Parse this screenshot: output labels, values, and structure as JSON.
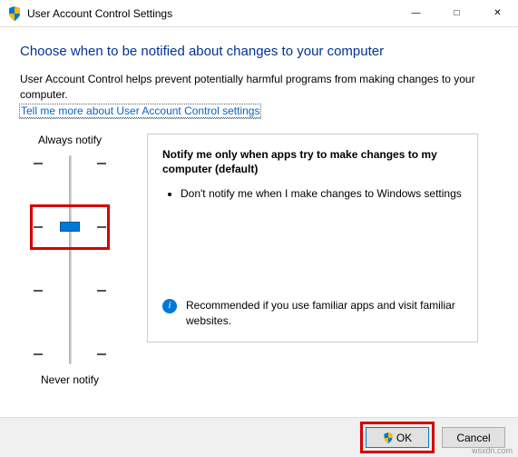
{
  "window": {
    "title": "User Account Control Settings"
  },
  "heading": "Choose when to be notified about changes to your computer",
  "subtext": "User Account Control helps prevent potentially harmful programs from making changes to your computer.",
  "link_text": "Tell me more about User Account Control settings",
  "slider": {
    "top_label": "Always notify",
    "bottom_label": "Never notify"
  },
  "description": {
    "title": "Notify me only when apps try to make changes to my computer (default)",
    "bullet1": "Don't notify me when I make changes to Windows settings",
    "recommendation": "Recommended if you use familiar apps and visit familiar websites."
  },
  "buttons": {
    "ok": "OK",
    "cancel": "Cancel"
  },
  "watermark": "wsxdn.com"
}
